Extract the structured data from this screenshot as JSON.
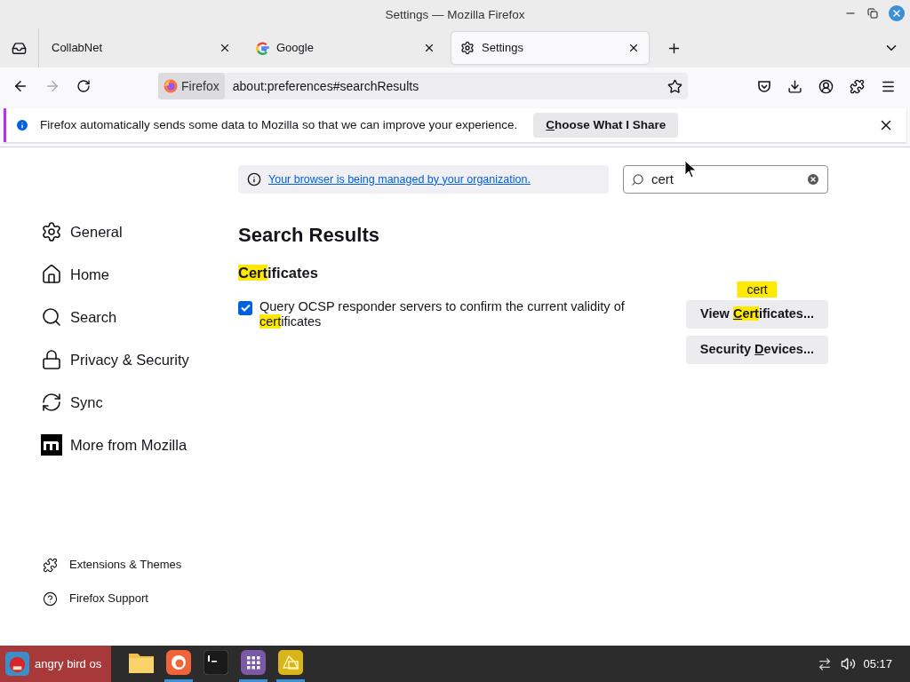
{
  "window": {
    "title": "Settings — Mozilla Firefox"
  },
  "tabs": [
    {
      "label": "CollabNet",
      "selected": false,
      "kind": "plain"
    },
    {
      "label": "Google",
      "selected": false,
      "kind": "google"
    },
    {
      "label": "Settings",
      "selected": true,
      "kind": "settings"
    }
  ],
  "address_bar": {
    "identity": "Firefox",
    "url": "about:preferences#searchResults"
  },
  "notification": {
    "message": "Firefox automatically sends some data to Mozilla so that we can improve your experience.",
    "button": [
      {
        "text": "C",
        "highlighted": false,
        "underlined": true
      },
      {
        "text": "hoose What I Share",
        "highlighted": false,
        "underlined": false
      }
    ]
  },
  "managed_notice": "Your browser is being managed by your organization.",
  "search": {
    "value": "cert"
  },
  "sidebar": {
    "items": [
      {
        "label": "General",
        "kind": "gear"
      },
      {
        "label": "Home",
        "kind": "home"
      },
      {
        "label": "Search",
        "kind": "search"
      },
      {
        "label": "Privacy & Security",
        "kind": "lock"
      },
      {
        "label": "Sync",
        "kind": "sync"
      },
      {
        "label": "More from Mozilla",
        "kind": "mozilla"
      }
    ],
    "footer": [
      {
        "label": "Extensions & Themes",
        "kind": "puzzle"
      },
      {
        "label": "Firefox Support",
        "kind": "help"
      }
    ]
  },
  "results": {
    "title": "Search Results",
    "heading": [
      {
        "text": "Cert",
        "highlighted": true,
        "underlined": false
      },
      {
        "text": "ificates",
        "highlighted": false,
        "underlined": false
      }
    ],
    "checkbox": {
      "checked": true,
      "label": [
        {
          "text": "Query OCSP responder servers to confirm the current validity of ",
          "highlighted": false,
          "underlined": false
        },
        {
          "text": "cert",
          "highlighted": true,
          "underlined": false
        },
        {
          "text": "ificates",
          "highlighted": false,
          "underlined": false
        }
      ]
    },
    "buttons": [
      {
        "tooltip": "cert",
        "label": [
          {
            "text": "View ",
            "highlighted": false,
            "underlined": false
          },
          {
            "text": "C",
            "highlighted": true,
            "underlined": true
          },
          {
            "text": "ert",
            "highlighted": true,
            "underlined": false
          },
          {
            "text": "ificates...",
            "highlighted": false,
            "underlined": false
          }
        ]
      },
      {
        "label": [
          {
            "text": "Security ",
            "highlighted": false,
            "underlined": false
          },
          {
            "text": "D",
            "highlighted": false,
            "underlined": true
          },
          {
            "text": "evices...",
            "highlighted": false,
            "underlined": false
          }
        ]
      }
    ]
  },
  "taskbar": {
    "start": "angry bird os",
    "apps": [
      {
        "kind": "folder",
        "running": false
      },
      {
        "kind": "firefox",
        "running": true
      },
      {
        "kind": "terminal",
        "running": false
      },
      {
        "kind": "grid",
        "running": true
      },
      {
        "kind": "yellow",
        "running": true
      }
    ],
    "clock": "05:17"
  }
}
